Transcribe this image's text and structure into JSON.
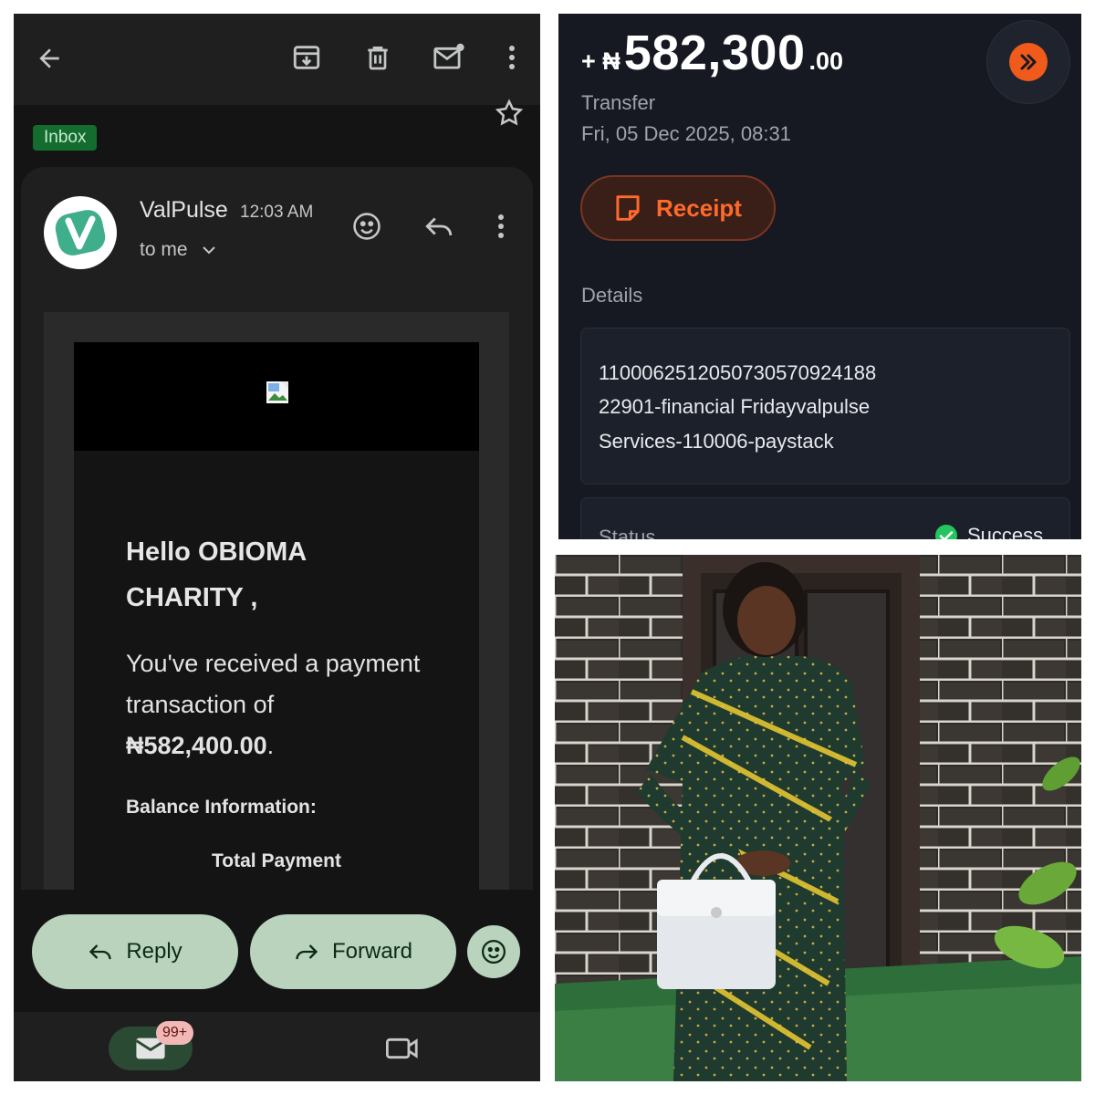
{
  "gmail": {
    "toolbar": {
      "back": "back-arrow-icon",
      "archive": "archive-icon",
      "delete": "trash-icon",
      "mark_unread": "mark-unread-icon",
      "more": "more-vert-icon"
    },
    "label_chip": "Inbox",
    "sender": "ValPulse",
    "time": "12:03 AM",
    "recipient": "to me",
    "avatar_text": "ValPulse",
    "email": {
      "greeting_line1": "Hello OBIOMA",
      "greeting_line2": "CHARITY ,",
      "message_line1": "You've received a payment",
      "message_line2": "transaction of",
      "amount": "₦582,400.00",
      "amount_suffix": ".",
      "balance_heading": "Balance Information:",
      "total_label": "Total Payment"
    },
    "actions": {
      "reply": "Reply",
      "forward": "Forward"
    },
    "nav": {
      "mail_badge": "99+"
    }
  },
  "bank": {
    "amount_sign": "+ ₦",
    "amount_main": "582,300",
    "amount_decimal": ".00",
    "type": "Transfer",
    "date": "Fri, 05 Dec 2025, 08:31",
    "receipt_label": "Receipt",
    "details_label": "Details",
    "details_lines": [
      "110006251205073057092418​8",
      "22901-financial Fridayvalpulse",
      "Services-110006-paystack"
    ],
    "status_label": "Status",
    "status_value": "Success"
  },
  "colors": {
    "gmail_bg": "#141414",
    "chip_green": "#146c2e",
    "pill_green": "#b9d3bd",
    "bank_bg": "#161922",
    "accent_orange": "#f05a1a",
    "success_green": "#22c55e"
  }
}
